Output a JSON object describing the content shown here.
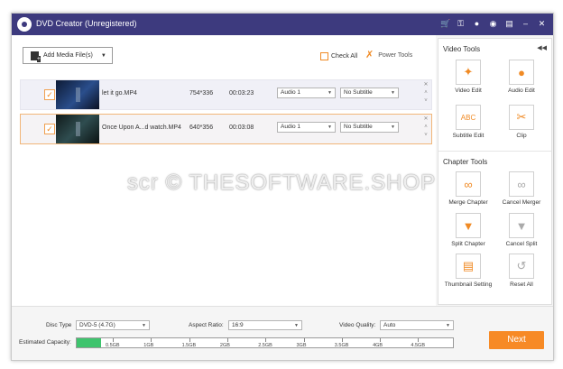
{
  "titlebar": {
    "title": "DVD Creator (Unregistered)"
  },
  "toolbar": {
    "add_media_label": "Add Media File(s)",
    "check_all_label": "Check All",
    "power_tools_label": "Power Tools"
  },
  "files": [
    {
      "name": "let it go.MP4",
      "resolution": "754*336",
      "duration": "00:03:23",
      "audio": "Audio 1",
      "subtitle": "No Subtitle",
      "checked": true
    },
    {
      "name": "Once Upon A...d watch.MP4",
      "resolution": "640*356",
      "duration": "00:03:08",
      "audio": "Audio 1",
      "subtitle": "No Subtitle",
      "checked": true
    }
  ],
  "video_tools": {
    "title": "Video Tools",
    "items": [
      {
        "label": "Video Edit",
        "icon": "magic-wand-icon"
      },
      {
        "label": "Audio Edit",
        "icon": "microphone-icon"
      },
      {
        "label": "Subtitle Edit",
        "icon": "abc-icon"
      },
      {
        "label": "Clip",
        "icon": "scissors-icon"
      }
    ]
  },
  "chapter_tools": {
    "title": "Chapter Tools",
    "items": [
      {
        "label": "Merge Chapter",
        "icon": "link-icon"
      },
      {
        "label": "Cancel Merger",
        "icon": "unlink-icon"
      },
      {
        "label": "Split Chapter",
        "icon": "split-icon"
      },
      {
        "label": "Cancel Split",
        "icon": "cancel-split-icon"
      },
      {
        "label": "Thumbnail Setting",
        "icon": "thumbnail-icon"
      },
      {
        "label": "Reset All",
        "icon": "reset-icon"
      }
    ]
  },
  "footer": {
    "disc_type_label": "Disc Type",
    "disc_type_value": "DVD-5 (4.7G)",
    "aspect_ratio_label": "Aspect Ratio:",
    "aspect_ratio_value": "16:9",
    "video_quality_label": "Video Quality:",
    "video_quality_value": "Auto",
    "capacity_label": "Estimated Capacity:",
    "capacity_ticks": [
      "0.5GB",
      "1GB",
      "1.5GB",
      "2GB",
      "2.5GB",
      "3GB",
      "3.5GB",
      "4GB",
      "4.5GB"
    ],
    "capacity_used_fraction": 0.065,
    "next_label": "Next"
  },
  "watermark": "scr © THESOFTWARE.SHOP",
  "colors": {
    "titlebar": "#3d3a7e",
    "accent": "#f78a25",
    "capacity": "#3ec46d"
  }
}
